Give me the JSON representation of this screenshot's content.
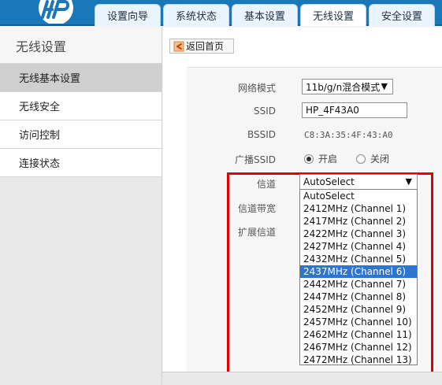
{
  "brand": {
    "logo_text": "hp"
  },
  "tabs": [
    {
      "label": "设置向导"
    },
    {
      "label": "系统状态"
    },
    {
      "label": "基本设置"
    },
    {
      "label": "无线设置",
      "active": true
    },
    {
      "label": "安全设置"
    }
  ],
  "sidebar": {
    "title": "无线设置",
    "items": [
      {
        "label": "无线基本设置",
        "active": true
      },
      {
        "label": "无线安全"
      },
      {
        "label": "访问控制"
      },
      {
        "label": "连接状态"
      }
    ]
  },
  "toolbar": {
    "back_label": "返回首页"
  },
  "form": {
    "network_mode": {
      "label": "网络模式",
      "value": "11b/g/n混合模式"
    },
    "ssid": {
      "label": "SSID",
      "value": "HP_4F43A0"
    },
    "bssid": {
      "label": "BSSID",
      "value": "C8:3A:35:4F:43:A0"
    },
    "broadcast_ssid": {
      "label": "广播SSID",
      "on_label": "开启",
      "off_label": "关闭",
      "selected": "on"
    },
    "channel": {
      "label": "信道",
      "value": "AutoSelect"
    },
    "channel_width": {
      "label": "信道带宽"
    },
    "extension_channel": {
      "label": "扩展信道"
    }
  },
  "channel_options": [
    "AutoSelect",
    "2412MHz (Channel 1)",
    "2417MHz (Channel 2)",
    "2422MHz (Channel 3)",
    "2427MHz (Channel 4)",
    "2432MHz (Channel 5)",
    "2437MHz (Channel 6)",
    "2442MHz (Channel 7)",
    "2447MHz (Channel 8)",
    "2452MHz (Channel 9)",
    "2457MHz (Channel 10)",
    "2462MHz (Channel 11)",
    "2467MHz (Channel 12)",
    "2472MHz (Channel 13)"
  ],
  "dropdown_selected_index": 6,
  "colors": {
    "header_blue": "#1a77b8",
    "highlight_red": "#e00000",
    "selection_blue": "#2f74d0"
  }
}
